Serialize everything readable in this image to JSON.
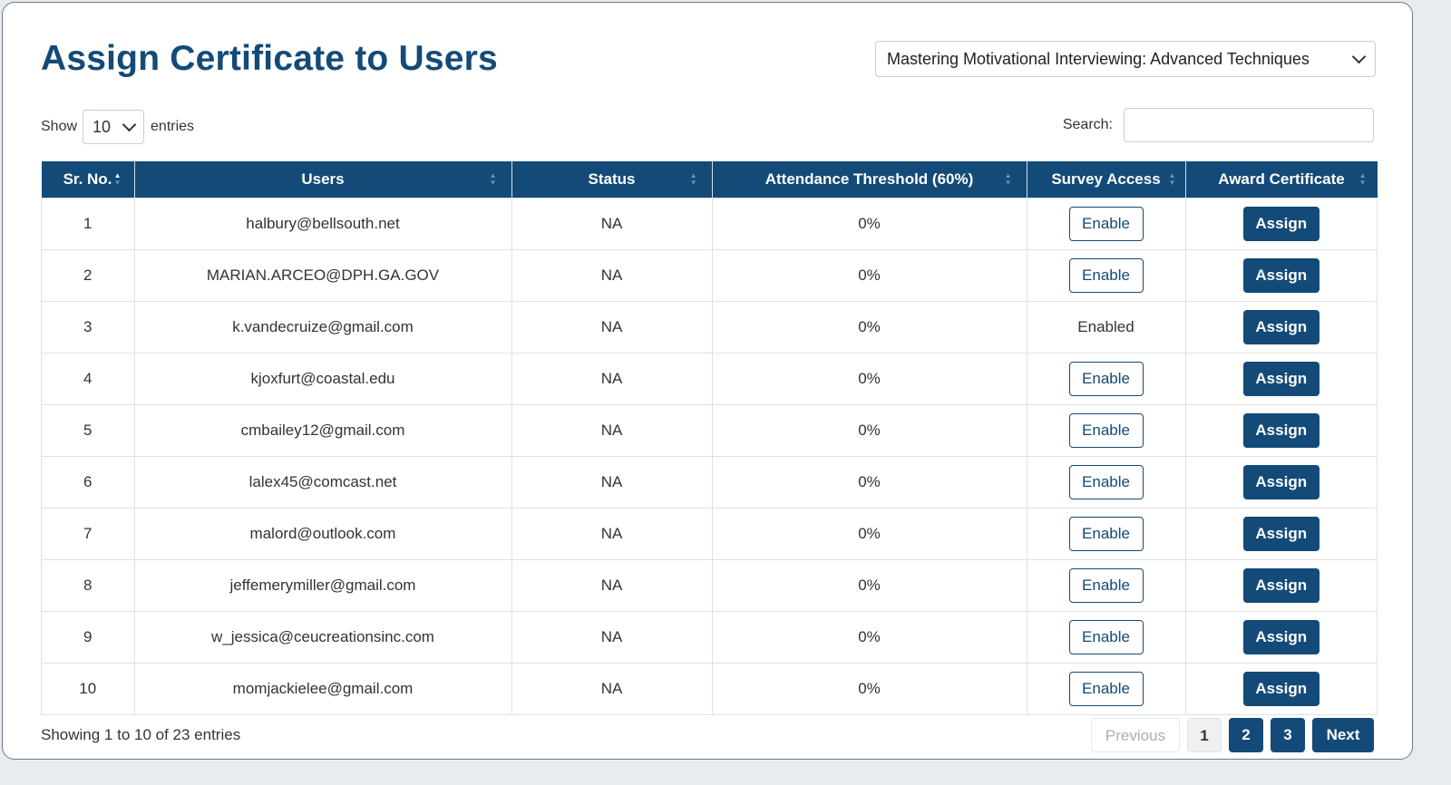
{
  "page": {
    "title": "Assign Certificate to Users",
    "course_select": {
      "value": "Mastering Motivational Interviewing: Advanced Techniques"
    }
  },
  "length": {
    "show_label": "Show",
    "value": "10",
    "entries_label": "entries"
  },
  "search": {
    "label": "Search:",
    "value": ""
  },
  "table": {
    "columns": [
      "Sr. No.",
      "Users",
      "Status",
      "Attendance Threshold (60%)",
      "Survey Access",
      "Award Certificate"
    ],
    "rows": [
      {
        "sr": "1",
        "user": "halbury@bellsouth.net",
        "status": "NA",
        "attendance": "0%",
        "survey": "Enable",
        "survey_enabled": false,
        "award": "Assign"
      },
      {
        "sr": "2",
        "user": "MARIAN.ARCEO@DPH.GA.GOV",
        "status": "NA",
        "attendance": "0%",
        "survey": "Enable",
        "survey_enabled": false,
        "award": "Assign"
      },
      {
        "sr": "3",
        "user": "k.vandecruize@gmail.com",
        "status": "NA",
        "attendance": "0%",
        "survey": "Enabled",
        "survey_enabled": true,
        "award": "Assign"
      },
      {
        "sr": "4",
        "user": "kjoxfurt@coastal.edu",
        "status": "NA",
        "attendance": "0%",
        "survey": "Enable",
        "survey_enabled": false,
        "award": "Assign"
      },
      {
        "sr": "5",
        "user": "cmbailey12@gmail.com",
        "status": "NA",
        "attendance": "0%",
        "survey": "Enable",
        "survey_enabled": false,
        "award": "Assign"
      },
      {
        "sr": "6",
        "user": "lalex45@comcast.net",
        "status": "NA",
        "attendance": "0%",
        "survey": "Enable",
        "survey_enabled": false,
        "award": "Assign"
      },
      {
        "sr": "7",
        "user": "malord@outlook.com",
        "status": "NA",
        "attendance": "0%",
        "survey": "Enable",
        "survey_enabled": false,
        "award": "Assign"
      },
      {
        "sr": "8",
        "user": "jeffemerymiller@gmail.com",
        "status": "NA",
        "attendance": "0%",
        "survey": "Enable",
        "survey_enabled": false,
        "award": "Assign"
      },
      {
        "sr": "9",
        "user": "w_jessica@ceucreationsinc.com",
        "status": "NA",
        "attendance": "0%",
        "survey": "Enable",
        "survey_enabled": false,
        "award": "Assign"
      },
      {
        "sr": "10",
        "user": "momjackielee@gmail.com",
        "status": "NA",
        "attendance": "0%",
        "survey": "Enable",
        "survey_enabled": false,
        "award": "Assign"
      }
    ]
  },
  "footer": {
    "info": "Showing 1 to 10 of 23 entries",
    "pagination": {
      "previous": "Previous",
      "pages": [
        "1",
        "2",
        "3"
      ],
      "next": "Next"
    }
  },
  "colors": {
    "primary": "#134a78",
    "border": "#dde2e6"
  },
  "icons": {
    "select_arrow": "chevron-down-icon",
    "sort": "sort-arrows-icon"
  }
}
